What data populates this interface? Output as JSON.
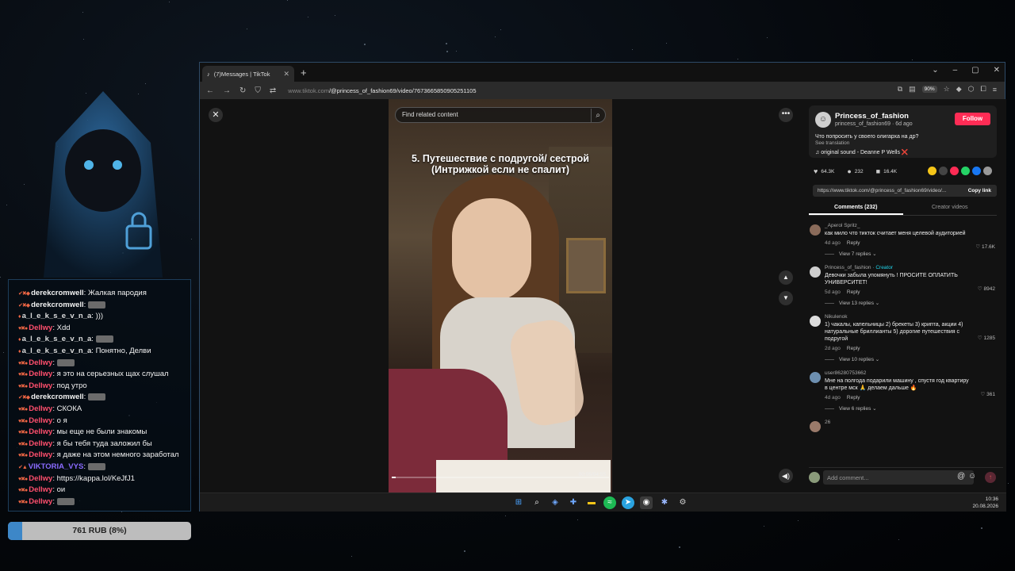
{
  "stream": {
    "chat": [
      {
        "nick": "derekcromwell",
        "color": "#f2f2f2",
        "badges": "✔✖◆",
        "message": "Жалкая пародия",
        "emote": false
      },
      {
        "nick": "derekcromwell",
        "color": "#f2f2f2",
        "badges": "✔✖◆",
        "message": "",
        "emote": true
      },
      {
        "nick": "a_l_e_k_s_e_v_n_a",
        "color": "#dddddd",
        "badges": "♦",
        "message": ")))",
        "emote": false
      },
      {
        "nick": "Dellwy",
        "color": "#ff4f6d",
        "badges": "♥✖●",
        "message": "Xdd",
        "emote": false
      },
      {
        "nick": "a_l_e_k_s_e_v_n_a",
        "color": "#dddddd",
        "badges": "♦",
        "message": "",
        "emote": true
      },
      {
        "nick": "a_l_e_k_s_e_v_n_a",
        "color": "#dddddd",
        "badges": "♦",
        "message": "Понятно, Делви",
        "emote": false
      },
      {
        "nick": "Dellwy",
        "color": "#ff4f6d",
        "badges": "♥✖●",
        "message": "",
        "emote": true
      },
      {
        "nick": "Dellwy",
        "color": "#ff4f6d",
        "badges": "♥✖●",
        "message": "я это на серьезных щах слушал",
        "emote": false
      },
      {
        "nick": "Dellwy",
        "color": "#ff4f6d",
        "badges": "♥✖●",
        "message": "под утро",
        "emote": false
      },
      {
        "nick": "derekcromwell",
        "color": "#f2f2f2",
        "badges": "✔✖◆",
        "message": "",
        "emote": true
      },
      {
        "nick": "Dellwy",
        "color": "#ff4f6d",
        "badges": "♥✖●",
        "message": "СКОКА",
        "emote": false
      },
      {
        "nick": "Dellwy",
        "color": "#ff4f6d",
        "badges": "♥✖●",
        "message": "о я",
        "emote": false
      },
      {
        "nick": "Dellwy",
        "color": "#ff4f6d",
        "badges": "♥✖●",
        "message": "мы еще не были знакомы",
        "emote": false
      },
      {
        "nick": "Dellwy",
        "color": "#ff4f6d",
        "badges": "♥✖●",
        "message": "я бы тебя туда заложил бы",
        "emote": false
      },
      {
        "nick": "Dellwy",
        "color": "#ff4f6d",
        "badges": "♥✖●",
        "message": "я даже на этом немного заработал",
        "emote": false
      },
      {
        "nick": "VIKTORIA_VYS",
        "color": "#8a6bff",
        "badges": "✔▲",
        "message": "",
        "emote": true
      },
      {
        "nick": "Dellwy",
        "color": "#ff4f6d",
        "badges": "♥✖●",
        "message": "https://kappa.lol/KeJfJ1",
        "emote": false
      },
      {
        "nick": "Dellwy",
        "color": "#ff4f6d",
        "badges": "♥✖●",
        "message": "ои",
        "emote": false
      },
      {
        "nick": "Dellwy",
        "color": "#ff4f6d",
        "badges": "♥✖●",
        "message": "",
        "emote": true
      }
    ],
    "donation": {
      "label": "761 RUB (8%)",
      "progress_percent": 8
    }
  },
  "browser": {
    "tab_title": "(7)Messages | TikTok",
    "url_host": "www.tiktok.com",
    "url_path": "/@princess_of_fashion69/video/7673665850905251105",
    "zoom": "90%"
  },
  "tiktok": {
    "search_placeholder": "Find related content",
    "video_caption": "5. Путешествие с подругой/ сестрой\n(Интрижкой если не спалит)",
    "timecode": "00:05/04:55",
    "progress_percent": 2,
    "profile": {
      "name": "Princess_of_fashion",
      "handle": "princess_of_fashion69 · 6d ago",
      "follow_label": "Follow",
      "description": "Что попросить у своего олигарха на др?",
      "see_translation": "See translation",
      "sound": "♫  original sound - Deanne P Wells ❌"
    },
    "stats": {
      "likes": "64.3K",
      "comments": "232",
      "saves": "16.4K"
    },
    "share_url": "https://www.tiktok.com/@princess_of_fashion69/video/...",
    "copy_link_label": "Copy link",
    "tabs": {
      "comments": "Comments (232)",
      "creator_videos": "Creator videos"
    },
    "comments": [
      {
        "user": "_Aperol Spritz_",
        "creator": "",
        "text": "как мило что тикток считает меня целевой аудиторией",
        "age": "4d ago",
        "reply": "Reply",
        "likes": "17.6K",
        "replies": "View 7 replies",
        "avatar_color": "#8a6b5a"
      },
      {
        "user": "Princess_of_fashion",
        "creator": "· Creator",
        "text": "Девочки забыла упомянуть ! ПРОСИТЕ ОПЛАТИТЬ УНИВЕРСИТЕТ!",
        "age": "5d ago",
        "reply": "Reply",
        "likes": "8942",
        "replies": "View 13 replies",
        "avatar_color": "#cfcfcf"
      },
      {
        "user": "Nikulenok",
        "creator": "",
        "text": "1) чакалы, капельницы 2) брекеты 3) крипта, акции 4) натуральные бриллианты 5) дорогие путешествия с подругой",
        "age": "2d ago",
        "reply": "Reply",
        "likes": "1285",
        "replies": "View 10 replies",
        "avatar_color": "#dcdcdc"
      },
      {
        "user": "user86280753662",
        "creator": "",
        "text": "Мне на полгода подарили машину , спустя год квартиру в центре мск 🙏 делаем дальше 🔥",
        "age": "4d ago",
        "reply": "Reply",
        "likes": "361",
        "replies": "View 6 replies",
        "avatar_color": "#6d8fb0"
      },
      {
        "user": "26",
        "creator": "",
        "text": "",
        "age": "",
        "reply": "",
        "likes": "",
        "replies": "",
        "avatar_color": "#9a7a6a"
      }
    ],
    "add_comment_placeholder": "Add comment..."
  },
  "taskbar": {
    "time": "10:36",
    "date": "20.08.2026"
  }
}
